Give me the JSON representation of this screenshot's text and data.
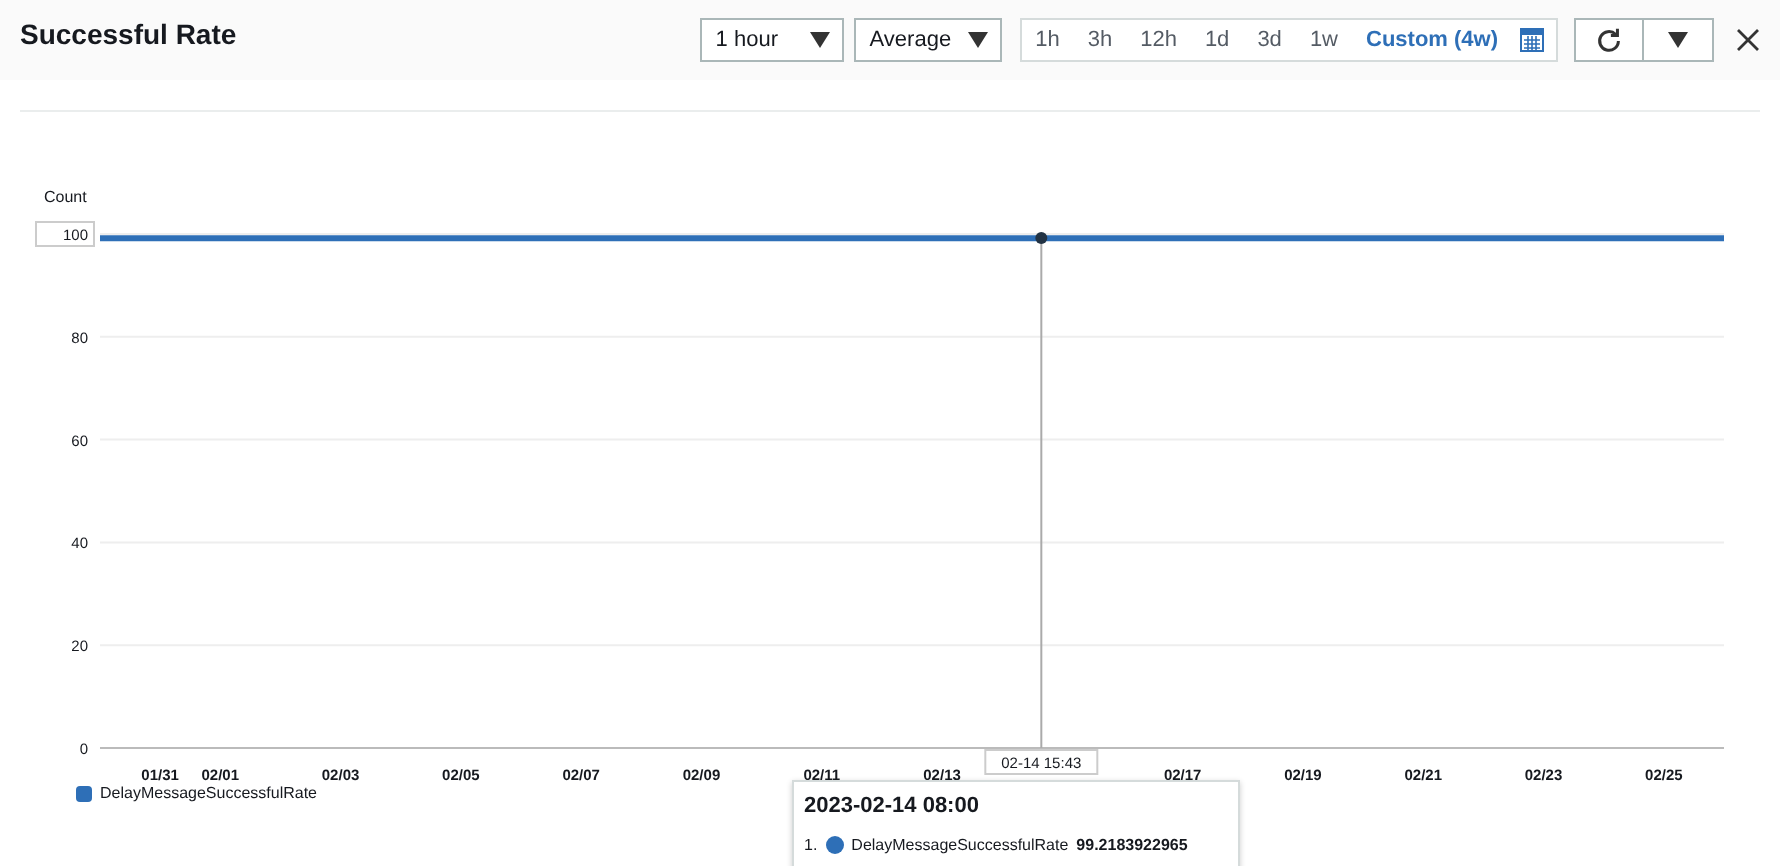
{
  "header": {
    "title": "Successful Rate",
    "period_select": "1 hour",
    "statistic_select": "Average",
    "time_ranges": [
      {
        "label": "1h",
        "selected": false
      },
      {
        "label": "3h",
        "selected": false
      },
      {
        "label": "12h",
        "selected": false
      },
      {
        "label": "1d",
        "selected": false
      },
      {
        "label": "3d",
        "selected": false
      },
      {
        "label": "1w",
        "selected": false
      },
      {
        "label": "Custom (4w)",
        "selected": true
      }
    ]
  },
  "chart": {
    "crosshair_label": "02-14 15:43",
    "chart_data": {
      "type": "line",
      "ylabel": "Count",
      "categories": [
        null,
        "01/31",
        "02/01",
        null,
        "02/03",
        null,
        "02/05",
        null,
        "02/07",
        null,
        "02/09",
        null,
        "02/11",
        null,
        "02/13",
        null,
        null,
        null,
        "02/17",
        null,
        "02/19",
        null,
        "02/21",
        null,
        "02/23",
        null,
        "02/25",
        null
      ],
      "series": [
        {
          "name": "DelayMessageSuccessfulRate",
          "color": "#2e6fb7",
          "values": [
            99.2,
            99.2,
            99.2,
            99.2,
            99.2,
            99.2,
            99.2,
            99.2,
            99.2,
            99.2,
            99.2,
            99.2,
            99.2,
            99.2,
            99.2,
            99.2,
            99.2,
            99.2,
            99.2,
            99.2,
            99.2,
            99.2,
            99.2,
            99.2,
            99.2,
            99.2,
            99.2,
            99.2
          ]
        }
      ],
      "ylim": [
        0,
        100
      ],
      "grid": true,
      "yticks": [
        0,
        20,
        40,
        60,
        80,
        100
      ]
    }
  },
  "tooltip": {
    "title": "2023-02-14 08:00",
    "rows": [
      {
        "index": "1.",
        "name": "DelayMessageSuccessfulRate",
        "value": "99.2183922965",
        "color": "#2e6fb7"
      }
    ]
  }
}
